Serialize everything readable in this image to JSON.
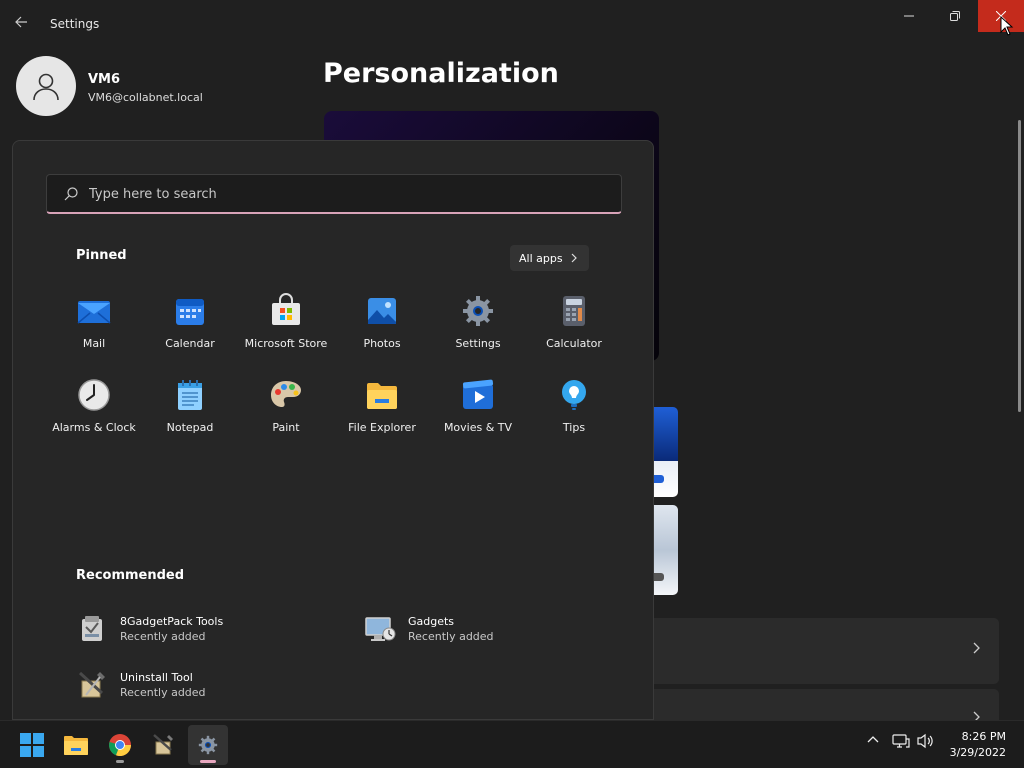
{
  "window": {
    "title": "Settings",
    "close_color": "#c42b1c"
  },
  "profile": {
    "name": "VM6",
    "email": "VM6@collabnet.local"
  },
  "page": {
    "title": "Personalization"
  },
  "start_menu": {
    "search_placeholder": "Type here to search",
    "pinned_title": "Pinned",
    "all_apps_label": "All apps",
    "pinned": [
      {
        "label": "Mail",
        "icon": "mail-icon"
      },
      {
        "label": "Calendar",
        "icon": "calendar-icon"
      },
      {
        "label": "Microsoft Store",
        "icon": "store-icon"
      },
      {
        "label": "Photos",
        "icon": "photos-icon"
      },
      {
        "label": "Settings",
        "icon": "settings-gear-icon"
      },
      {
        "label": "Calculator",
        "icon": "calculator-icon"
      },
      {
        "label": "Alarms & Clock",
        "icon": "clock-icon"
      },
      {
        "label": "Notepad",
        "icon": "notepad-icon"
      },
      {
        "label": "Paint",
        "icon": "paint-palette-icon"
      },
      {
        "label": "File Explorer",
        "icon": "folder-icon"
      },
      {
        "label": "Movies & TV",
        "icon": "movies-icon"
      },
      {
        "label": "Tips",
        "icon": "lightbulb-icon"
      }
    ],
    "recommended_title": "Recommended",
    "recommended": [
      {
        "name": "8GadgetPack Tools",
        "sub": "Recently added",
        "icon": "gadgetpack-tools-icon"
      },
      {
        "name": "Gadgets",
        "sub": "Recently added",
        "icon": "gadgets-icon"
      },
      {
        "name": "Uninstall Tool",
        "sub": "Recently added",
        "icon": "uninstall-tool-icon"
      }
    ]
  },
  "taskbar": {
    "items": [
      "start-windows-icon",
      "file-explorer-icon",
      "chrome-icon",
      "uninstall-tool-icon",
      "settings-icon"
    ],
    "accent": "#e8a7bf",
    "time": "8:26 PM",
    "date": "3/29/2022"
  }
}
